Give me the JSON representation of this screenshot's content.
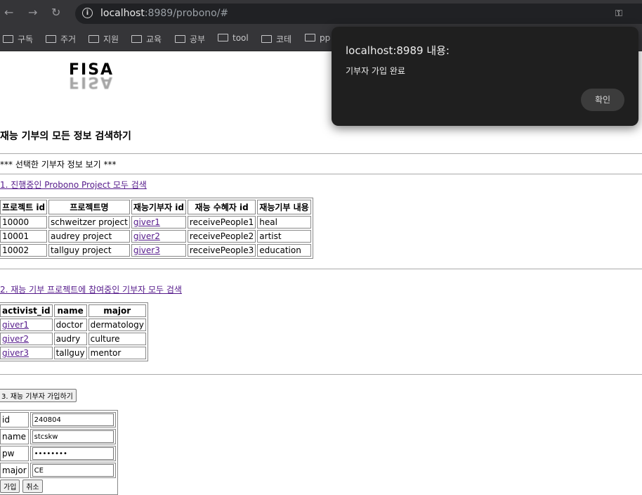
{
  "browser": {
    "url_host": "localhost",
    "url_rest": ":8989/probono/#",
    "bookmarks": [
      "구독",
      "주거",
      "지원",
      "교육",
      "공부",
      "tool",
      "코테",
      "pp"
    ]
  },
  "logo": {
    "text": "FISA"
  },
  "page": {
    "title": "재능 기부의 모든 정보 검색하기",
    "selected_info": "*** 선택한 기부자 정보 보기 ***",
    "link1": "1. 진행중인 Probono Project 모두 검색",
    "link2": "2. 재능 기부 프로젝트에 참여중인 기부자 모두 검색",
    "signup_button": "3. 재능 기부자 가입하기"
  },
  "projects": {
    "headers": [
      "프로젝트 id",
      "프로젝트명",
      "재능기부자 id",
      "재능 수혜자 id",
      "재능기부 내용"
    ],
    "rows": [
      [
        "10000",
        "schweitzer project",
        "giver1",
        "receivePeople1",
        "heal"
      ],
      [
        "10001",
        "audrey project",
        "giver2",
        "receivePeople2",
        "artist"
      ],
      [
        "10002",
        "tallguy project",
        "giver3",
        "receivePeople3",
        "education"
      ]
    ]
  },
  "activists": {
    "headers": [
      "activist_id",
      "name",
      "major"
    ],
    "rows": [
      [
        "giver1",
        "doctor",
        "dermatology"
      ],
      [
        "giver2",
        "audry",
        "culture"
      ],
      [
        "giver3",
        "tallguy",
        "mentor"
      ]
    ]
  },
  "form": {
    "id_label": "id",
    "id_value": "240804",
    "name_label": "name",
    "name_value": "stcskw",
    "pw_label": "pw",
    "pw_value": "••••••••",
    "major_label": "major",
    "major_value": "CE",
    "submit": "가입",
    "reset": "취소"
  },
  "dialog": {
    "title": "localhost:8989 내용:",
    "message": "기부자 가입 완료",
    "ok": "확인"
  }
}
